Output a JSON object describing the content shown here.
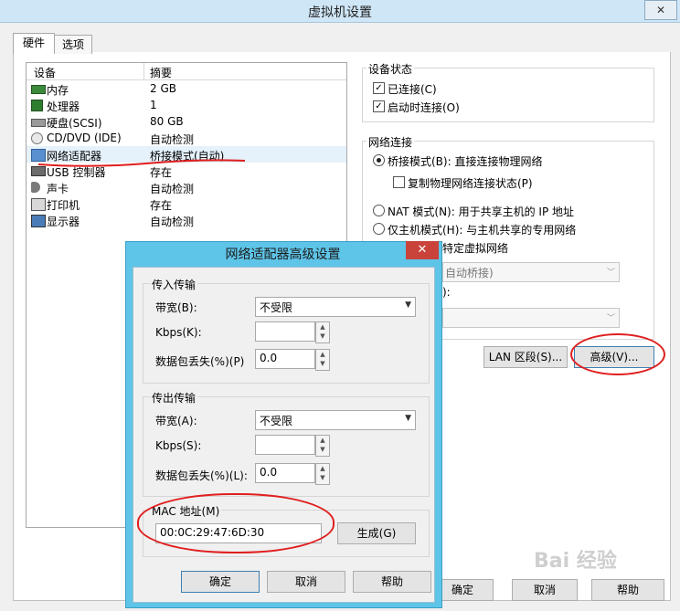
{
  "window": {
    "title": "虚拟机设置",
    "close": "✕"
  },
  "tabs": [
    "硬件",
    "选项"
  ],
  "device_list": {
    "headers": [
      "设备",
      "摘要"
    ],
    "rows": [
      {
        "name": "内存",
        "summary": "2 GB",
        "icon": "memory-icon"
      },
      {
        "name": "处理器",
        "summary": "1",
        "icon": "cpu-icon"
      },
      {
        "name": "硬盘(SCSI)",
        "summary": "80 GB",
        "icon": "hard-disk-icon"
      },
      {
        "name": "CD/DVD (IDE)",
        "summary": "自动检测",
        "icon": "cd-dvd-icon"
      },
      {
        "name": "网络适配器",
        "summary": "桥接模式(自动)",
        "icon": "network-adapter-icon"
      },
      {
        "name": "USB 控制器",
        "summary": "存在",
        "icon": "usb-icon"
      },
      {
        "name": "声卡",
        "summary": "自动检测",
        "icon": "sound-card-icon"
      },
      {
        "name": "打印机",
        "summary": "存在",
        "icon": "printer-icon"
      },
      {
        "name": "显示器",
        "summary": "自动检测",
        "icon": "display-icon"
      }
    ]
  },
  "device_status": {
    "label": "设备状态",
    "connected": "已连接(C)",
    "connect_on_power": "启动时连接(O)"
  },
  "network_connection": {
    "label": "网络连接",
    "bridged": "桥接模式(B): 直接连接物理网络",
    "replicate": "复制物理网络连接状态(P)",
    "nat": "NAT 模式(N): 用于共享主机的 IP 地址",
    "host_only": "仅主机模式(H): 与主机共享的专用网络",
    "custom_partial": "特定虚拟网络",
    "combo1_partial": "自动桥接)",
    "label2_partial": "):",
    "lan_button": "LAN 区段(S)...",
    "advanced_button": "高级(V)..."
  },
  "footer": {
    "ok": "确定",
    "cancel": "取消",
    "help": "帮助"
  },
  "dialog": {
    "title": "网络适配器高级设置",
    "close": "✕",
    "incoming": {
      "label": "传入传输",
      "bandwidth_label": "带宽(B):",
      "bandwidth_value": "不受限",
      "kbps_label": "Kbps(K):",
      "kbps_value": "",
      "loss_label": "数据包丢失(%)(P)",
      "loss_value": "0.0"
    },
    "outgoing": {
      "label": "传出传输",
      "bandwidth_label": "带宽(A):",
      "bandwidth_value": "不受限",
      "kbps_label": "Kbps(S):",
      "kbps_value": "",
      "loss_label": "数据包丢失(%)(L):",
      "loss_value": "0.0"
    },
    "mac": {
      "label": "MAC 地址(M)",
      "value": "00:0C:29:47:6D:30",
      "generate": "生成(G)"
    },
    "ok": "确定",
    "cancel": "取消",
    "help": "帮助"
  },
  "watermark": "Bai 经验",
  "colors": {
    "selection": "#e5f1fb",
    "dialog_frame": "#5ec4e8",
    "annotation": "#e01e1e"
  }
}
